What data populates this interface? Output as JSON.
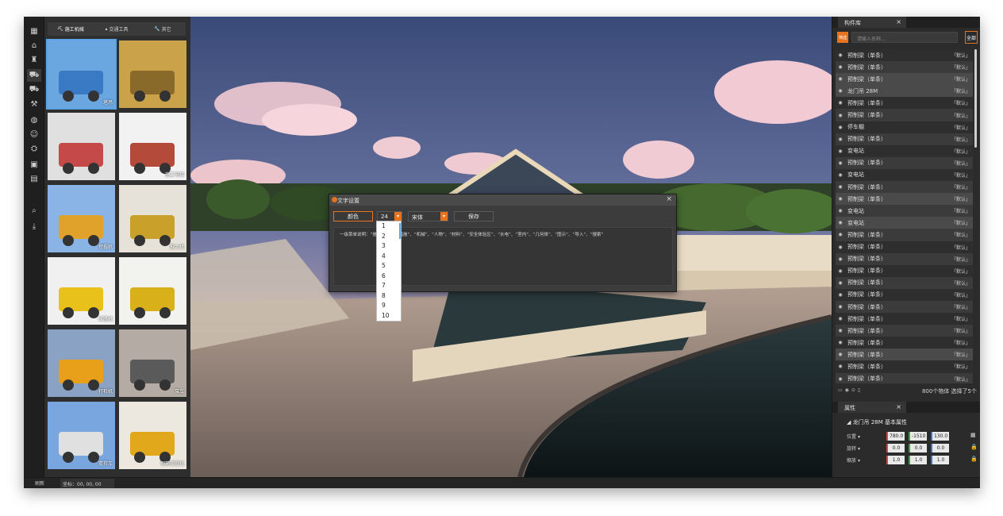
{
  "rail": {
    "icons": [
      "grid-icon",
      "home-icon",
      "crane-icon",
      "machine-icon",
      "truck-icon",
      "tool-icon",
      "globe-icon",
      "people-icon",
      "vehicle-icon",
      "monitor-icon",
      "board-icon",
      "search-icon",
      "download-icon"
    ]
  },
  "library": {
    "tabs": [
      {
        "label": "施工机械",
        "icon": "excavator-icon"
      },
      {
        "label": "交通工具",
        "icon": "car-icon"
      },
      {
        "label": "其它",
        "icon": "wrench-icon"
      }
    ],
    "items": [
      {
        "label": "塔吊"
      },
      {
        "label": ""
      },
      {
        "label": ""
      },
      {
        "label": "施工电梯"
      },
      {
        "label": "挖掘机"
      },
      {
        "label": "推土机"
      },
      {
        "label": "压路机"
      },
      {
        "label": ""
      },
      {
        "label": "打桩机"
      },
      {
        "label": "泵车"
      },
      {
        "label": "搅拌车"
      },
      {
        "label": "钢筋调直机"
      }
    ]
  },
  "status": {
    "refresh_label": "刷新",
    "coord_text": "坐标：00, 00, 00"
  },
  "dialog": {
    "title": "文字设置",
    "color_button": "颜色",
    "font_size": "24",
    "font_family": "宋体",
    "save_button": "保存",
    "text_content": "一级菜单说明：“施工机械”、“措施”、“机械”、“人物”、“材料”、“安全体验区”、“水电”、“室内”、“几何体”、“图示”、“导入”、“搜索”",
    "size_options": [
      "1",
      "2",
      "3",
      "4",
      "5",
      "6",
      "7",
      "8",
      "9",
      "10"
    ]
  },
  "library_panel": {
    "tab_title": "构件库",
    "filter_label": "筛选",
    "search_placeholder": "请输入名称...",
    "all_button": "全部",
    "items": [
      {
        "name": "预制梁（单条）",
        "tag": "「默认」"
      },
      {
        "name": "预制梁（单条）",
        "tag": "「默认」"
      },
      {
        "name": "预制梁（单条）",
        "tag": "「默认」"
      },
      {
        "name": "龙门吊 28M",
        "tag": "「默认」"
      },
      {
        "name": "预制梁（单条）",
        "tag": "「默认」"
      },
      {
        "name": "预制梁（单条）",
        "tag": "「默认」"
      },
      {
        "name": "停车棚",
        "tag": "「默认」"
      },
      {
        "name": "预制梁（单条）",
        "tag": "「默认」"
      },
      {
        "name": "变电站",
        "tag": "「默认」"
      },
      {
        "name": "预制梁（单条）",
        "tag": "「默认」"
      },
      {
        "name": "变电站",
        "tag": "「默认」"
      },
      {
        "name": "预制梁（单条）",
        "tag": "「默认」"
      },
      {
        "name": "预制梁（单条）",
        "tag": "「默认」"
      },
      {
        "name": "变电站",
        "tag": "「默认」"
      },
      {
        "name": "变电站",
        "tag": "「默认」"
      },
      {
        "name": "预制梁（单条）",
        "tag": "「默认」"
      },
      {
        "name": "预制梁（单条）",
        "tag": "「默认」"
      },
      {
        "name": "预制梁（单条）",
        "tag": "「默认」"
      },
      {
        "name": "预制梁（单条）",
        "tag": "「默认」"
      },
      {
        "name": "预制梁（单条）",
        "tag": "「默认」"
      },
      {
        "name": "预制梁（单条）",
        "tag": "「默认」"
      },
      {
        "name": "预制梁（单条）",
        "tag": "「默认」"
      },
      {
        "name": "预制梁（单条）",
        "tag": "「默认」"
      },
      {
        "name": "预制梁（单条）",
        "tag": "「默认」"
      },
      {
        "name": "预制梁（单条）",
        "tag": "「默认」"
      },
      {
        "name": "预制梁（单条）",
        "tag": "「默认」"
      },
      {
        "name": "预制梁（单条）",
        "tag": "「默认」"
      },
      {
        "name": "预制梁（单条）",
        "tag": "「默认」"
      }
    ],
    "footer_count": "800个物体 选择了5个"
  },
  "properties": {
    "tab_title": "属性",
    "section_title": "龙门吊 28M 基本属性",
    "position_label": "位置",
    "rotation_label": "旋转",
    "scale_label": "缩放",
    "position": [
      "780.0",
      "-1510",
      "130.0"
    ],
    "rotation": [
      "0.0",
      "0.0",
      "0.0"
    ],
    "scale": [
      "1.0",
      "1.0",
      "1.0"
    ]
  }
}
